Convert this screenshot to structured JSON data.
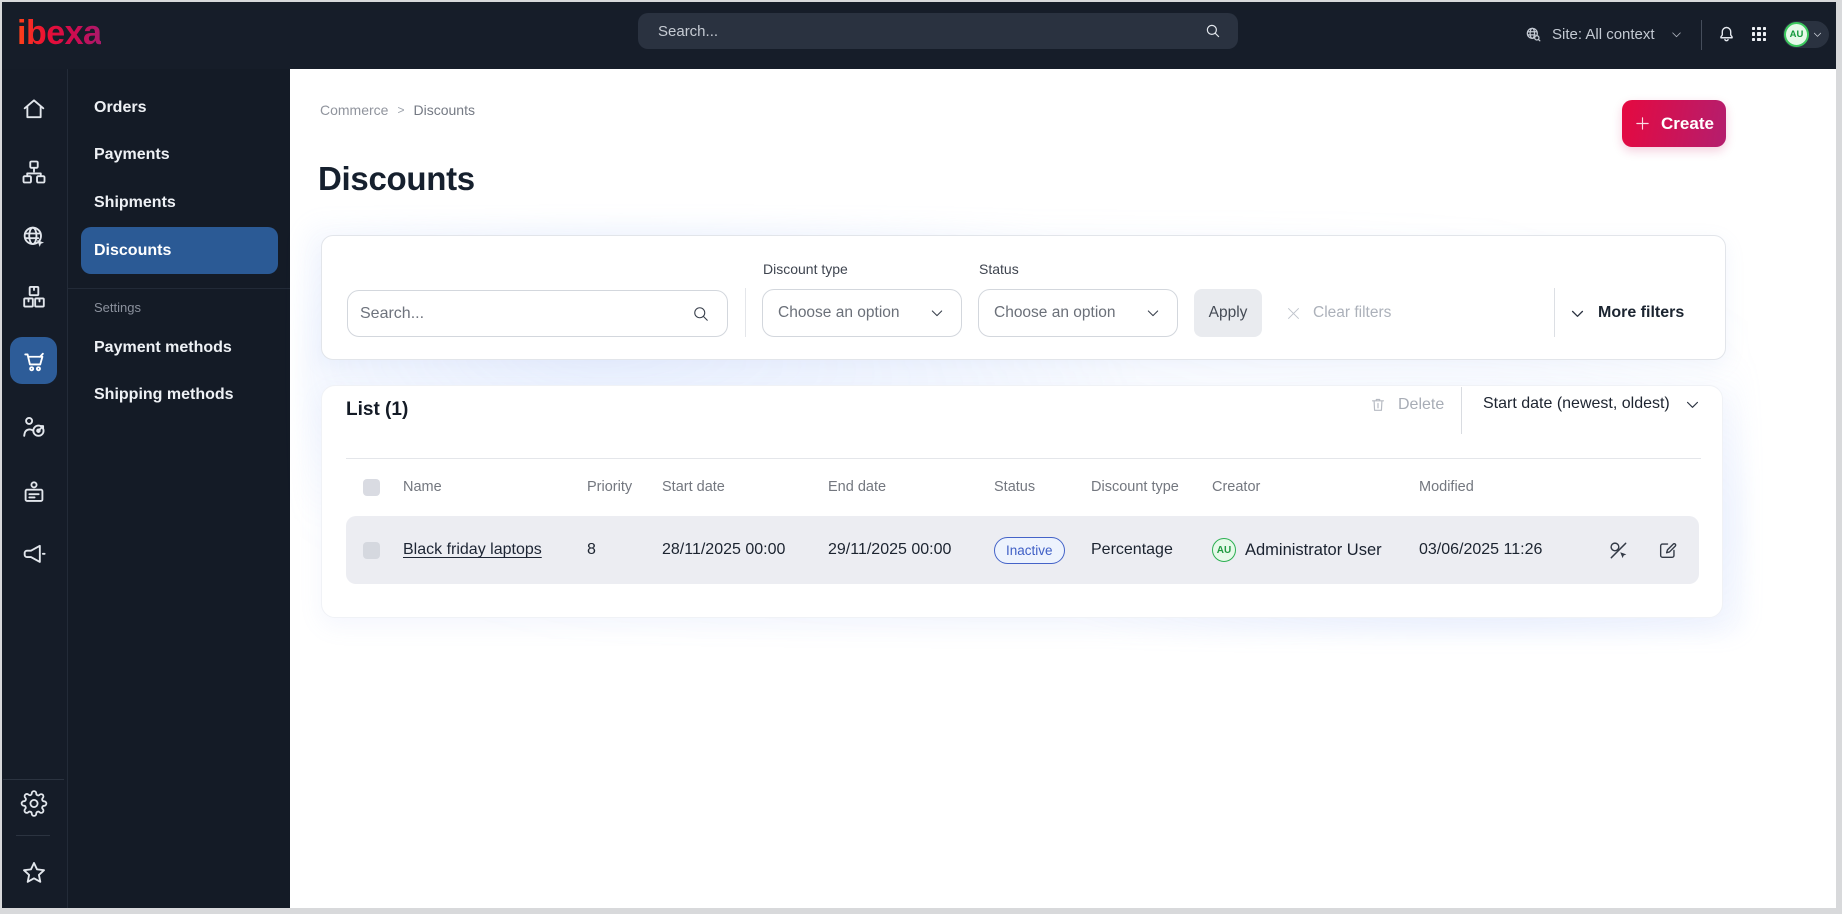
{
  "topbar": {
    "logo": "ibexa",
    "search_placeholder": "Search...",
    "site_label": "Site: All context",
    "avatar_initials": "AU"
  },
  "sidebar": {
    "rail_icons": [
      "home",
      "sitemap",
      "site-context",
      "products",
      "commerce",
      "personalization",
      "corporate",
      "engage",
      "settings",
      "bookmarks"
    ],
    "menu": {
      "items": [
        {
          "label": "Orders"
        },
        {
          "label": "Payments"
        },
        {
          "label": "Shipments"
        },
        {
          "label": "Discounts",
          "active": true
        }
      ],
      "section_label": "Settings",
      "settings_items": [
        {
          "label": "Payment methods"
        },
        {
          "label": "Shipping methods"
        }
      ]
    }
  },
  "breadcrumb": {
    "root": "Commerce",
    "current": "Discounts"
  },
  "page": {
    "title": "Discounts",
    "create_label": "Create"
  },
  "filters": {
    "search_placeholder": "Search...",
    "discount_type_label": "Discount type",
    "discount_type_value": "Choose an option",
    "status_label": "Status",
    "status_value": "Choose an option",
    "apply_label": "Apply",
    "clear_label": "Clear filters",
    "more_label": "More filters"
  },
  "list": {
    "title": "List (1)",
    "delete_label": "Delete",
    "sort_label": "Start date (newest, oldest)",
    "columns": [
      "Name",
      "Priority",
      "Start date",
      "End date",
      "Status",
      "Discount type",
      "Creator",
      "Modified"
    ],
    "rows": [
      {
        "name": "Black friday laptops",
        "priority": "8",
        "start_date": "28/11/2025 00:00",
        "end_date": "29/11/2025 00:00",
        "status": "Inactive",
        "discount_type": "Percentage",
        "creator": "Administrator User",
        "creator_initials": "AU",
        "modified": "03/06/2025 11:26"
      }
    ]
  },
  "colors": {
    "accent_red": "#e50940",
    "accent_pink": "#b41e6e",
    "active_blue": "#2b5a95",
    "badge_blue": "#3f5fc5",
    "creator_green": "#2db052"
  }
}
